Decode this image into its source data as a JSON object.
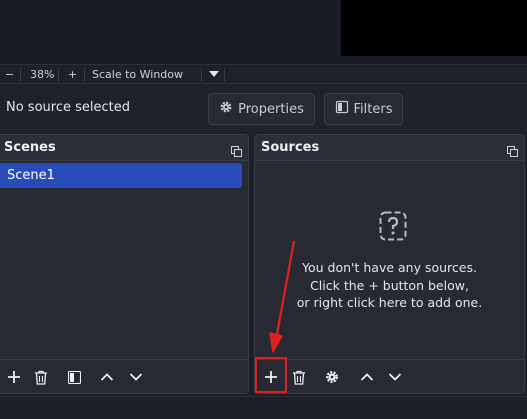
{
  "zoom_bar": {
    "minus": "−",
    "zoom": "38%",
    "plus": "+",
    "scale_mode": "Scale to Window"
  },
  "context_bar": {
    "status": "No source selected",
    "properties_label": "Properties",
    "filters_label": "Filters"
  },
  "scenes": {
    "title": "Scenes",
    "items": [
      "Scene1"
    ]
  },
  "sources": {
    "title": "Sources",
    "empty_lines": [
      "You don't have any sources.",
      "Click the + button below,",
      "or right click here to add one."
    ]
  },
  "colors": {
    "selection": "#284cb8",
    "annotation": "#e0201c"
  }
}
